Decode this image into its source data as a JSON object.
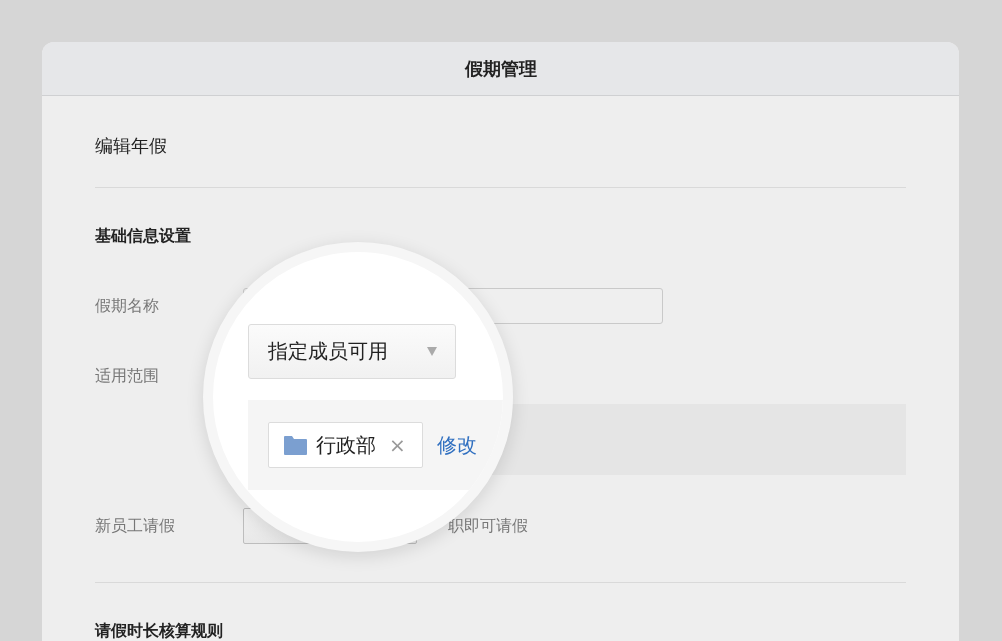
{
  "window": {
    "title": "假期管理"
  },
  "page_title": "编辑年假",
  "basic_section": {
    "title": "基础信息设置",
    "fields": [
      {
        "kind": "input",
        "label": "假期名称"
      },
      {
        "kind": "scope",
        "label": "适用范围"
      },
      {
        "kind": "select",
        "label": "新员工请假",
        "note": "职即可请假"
      }
    ]
  },
  "next_section": {
    "title": "请假时长核算规则"
  },
  "magnifier": {
    "scope_select": {
      "value": "指定成员可用"
    },
    "chips": [
      {
        "label": "行政部",
        "remove": "×"
      }
    ],
    "edit_link": "修改"
  }
}
